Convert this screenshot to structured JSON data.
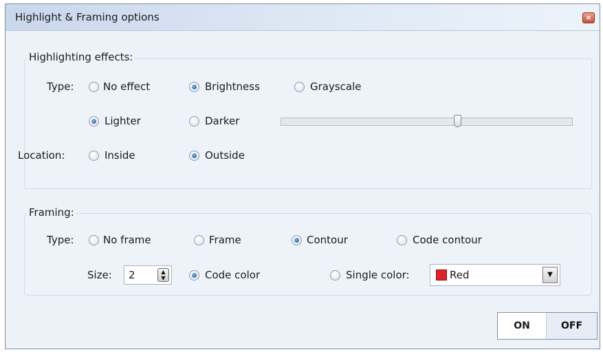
{
  "window": {
    "title": "Highlight & Framing options",
    "close_glyph": "×"
  },
  "highlighting": {
    "legend": "Highlighting effects:",
    "type_label": "Type:",
    "type_options": [
      {
        "label": "No effect",
        "checked": false
      },
      {
        "label": "Brightness",
        "checked": true
      },
      {
        "label": "Grayscale",
        "checked": false
      }
    ],
    "shade_options": [
      {
        "label": "Lighter",
        "checked": true
      },
      {
        "label": "Darker",
        "checked": false
      }
    ],
    "brightness_level": 0.61,
    "location_label": "Location:",
    "location_options": [
      {
        "label": "Inside",
        "checked": false
      },
      {
        "label": "Outside",
        "checked": true
      }
    ]
  },
  "framing": {
    "legend": "Framing:",
    "type_label": "Type:",
    "type_options": [
      {
        "label": "No frame",
        "checked": false
      },
      {
        "label": "Frame",
        "checked": false
      },
      {
        "label": "Contour",
        "checked": true
      },
      {
        "label": "Code contour",
        "checked": false
      }
    ],
    "size_label": "Size:",
    "size_value": "2",
    "color_options": [
      {
        "label": "Code color",
        "checked": true
      },
      {
        "label": "Single color:",
        "checked": false
      }
    ],
    "single_color": {
      "name": "Red",
      "swatch": "#e0202a"
    }
  },
  "toggle": {
    "on_label": "ON",
    "off_label": "OFF",
    "active": "ON"
  },
  "icons": {
    "spin": "up-down-arrow-icon",
    "dropdown": "chevron-down-icon",
    "close": "close-icon"
  }
}
